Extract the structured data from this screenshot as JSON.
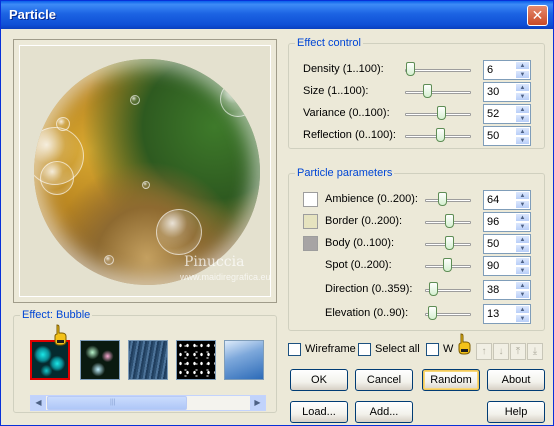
{
  "window": {
    "title": "Particle",
    "close_glyph": "✕"
  },
  "preview": {
    "watermark": "Pinuccia",
    "watermark_url": "www.maidiregrafica.eu"
  },
  "effect": {
    "legend": "Effect: Bubble",
    "thumbs": [
      "bubble",
      "glow-dots",
      "rain",
      "stars",
      "sky"
    ],
    "selected": 0
  },
  "effect_control": {
    "legend": "Effect control",
    "rows": [
      {
        "label": "Density (1..100):",
        "value": "6"
      },
      {
        "label": "Size (1..100):",
        "value": "30"
      },
      {
        "label": "Variance (0..100):",
        "value": "52"
      },
      {
        "label": "Reflection (0..100):",
        "value": "50"
      }
    ]
  },
  "particle_parameters": {
    "legend": "Particle parameters",
    "rows": [
      {
        "label": "Ambience (0..200):",
        "value": "64",
        "swatch": "#FFFFFF"
      },
      {
        "label": "Border (0..200):",
        "value": "96",
        "swatch": "#E6E3BF"
      },
      {
        "label": "Body (0..100):",
        "value": "50",
        "swatch": "#A7A4A4"
      },
      {
        "label": "Spot (0..200):",
        "value": "90",
        "swatch": ""
      },
      {
        "label": "Direction (0..359):",
        "value": "38",
        "swatch": ""
      },
      {
        "label": "Elevation (0..90):",
        "value": "13",
        "swatch": ""
      }
    ]
  },
  "options": {
    "wireframe": "Wireframe",
    "select_all": "Select all",
    "third": "W"
  },
  "buttons": {
    "ok": "OK",
    "cancel": "Cancel",
    "random": "Random",
    "about": "About",
    "load": "Load...",
    "add": "Add...",
    "help": "Help"
  },
  "order_arrows": [
    "↑",
    "↓",
    "⤒",
    "⤓"
  ],
  "scroll": {
    "left": "◀",
    "right": "▶",
    "grip": "|||"
  }
}
